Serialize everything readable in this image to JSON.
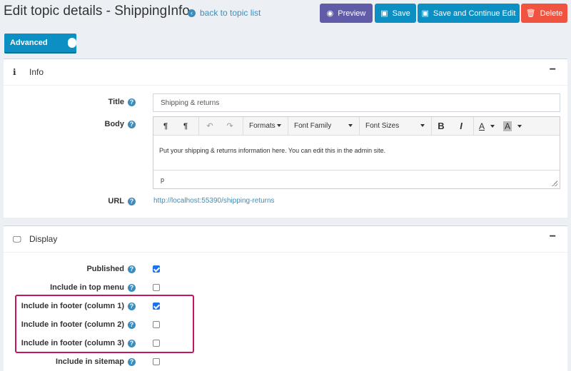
{
  "header": {
    "title": "Edit topic details - ShippingInfo",
    "back_link": "back to topic list",
    "buttons": {
      "preview": "Preview",
      "save": "Save",
      "save_continue": "Save and Continue Edit",
      "delete": "Delete"
    }
  },
  "advanced_toggle": {
    "label": "Advanced",
    "on": true
  },
  "info_panel": {
    "title": "Info",
    "collapse": "−",
    "fields": {
      "title_label": "Title",
      "title_value": "Shipping & returns",
      "body_label": "Body",
      "url_label": "URL",
      "url_value": "http://localhost:55390/shipping-returns"
    },
    "editor": {
      "toolbar": {
        "ltr": "¶",
        "rtl": "¶",
        "undo": "↶",
        "redo": "↷",
        "formats": "Formats",
        "font_family": "Font Family",
        "font_sizes": "Font Sizes",
        "bold": "B",
        "italic": "I",
        "text_color": "A",
        "bg_color": "A"
      },
      "content": "Put your shipping & returns information here. You can edit this in the admin site.",
      "status_path": "p"
    }
  },
  "display_panel": {
    "title": "Display",
    "collapse": "−",
    "fields": [
      {
        "label": "Published",
        "checked": true
      },
      {
        "label": "Include in top menu",
        "checked": false
      },
      {
        "label": "Include in footer (column 1)",
        "checked": true
      },
      {
        "label": "Include in footer (column 2)",
        "checked": false
      },
      {
        "label": "Include in footer (column 3)",
        "checked": false
      },
      {
        "label": "Include in sitemap",
        "checked": false
      }
    ]
  },
  "icons": {
    "info": "info-icon",
    "display": "monitor-icon",
    "help": "question-circle-icon"
  },
  "colors": {
    "preview": "#605ca8",
    "primary": "#0c8fc3",
    "danger": "#f0533f",
    "highlight": "#c2185b"
  }
}
